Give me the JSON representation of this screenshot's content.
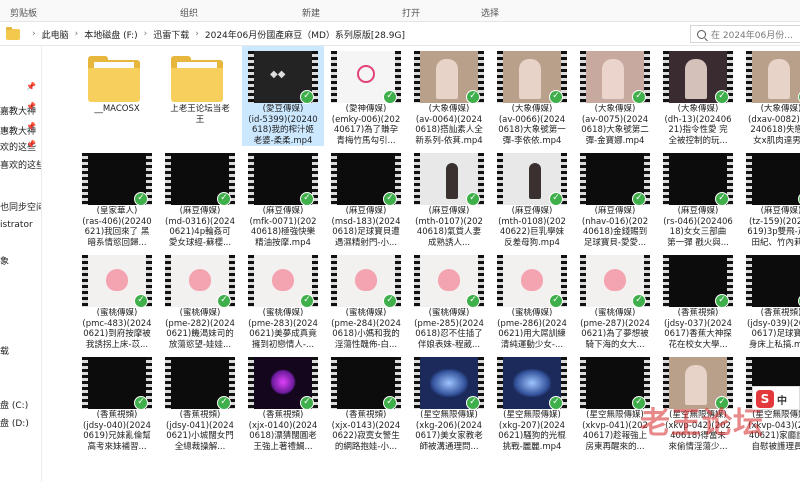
{
  "ribbon": {
    "items": [
      "剪贴板",
      "组织",
      "新建",
      "打开",
      "选择"
    ]
  },
  "address": {
    "crumbs": [
      "此电脑",
      "本地磁盘 (F:)",
      "迅雷下载",
      "2024年06月份國產麻豆（MD）系列原版[28.9G]"
    ],
    "search_placeholder": "在 2024年06月份..."
  },
  "sidebar": {
    "items": [
      "嘉教大神",
      "惠教大神",
      "欢的这些",
      "喜欢的这些",
      "也同步空间",
      "istrator",
      "象",
      "载",
      "盘 (C:)",
      "盘 (D:)"
    ]
  },
  "folders": [
    {
      "name": "__MACOSX"
    },
    {
      "name": "上老王论坛当老\n王"
    }
  ],
  "videos": [
    {
      "caption": "(愛豆傳媒)\n(id-5399)(20240\n618)我的榨汁姬\n老婆-柔柔.mp4",
      "scene": "logo-dark",
      "selected": true
    },
    {
      "caption": "(愛神傳媒)\n(emky-006)(202\n40617)為了賺孕\n青梅竹馬勾引...",
      "scene": "logo-white"
    },
    {
      "caption": "(大象傳媒)\n(av-0064)(2024\n0618)搭訕素人全\n新系列-依萁.mp4",
      "scene": "room"
    },
    {
      "caption": "(大象傳媒)\n(av-0066)(2024\n0618)大象號第一\n彈-李依依.mp4",
      "scene": "room"
    },
    {
      "caption": "(大象傳媒)\n(av-0075)(2024\n0618)大象號第二\n彈-金寶娜.mp4",
      "scene": "room2"
    },
    {
      "caption": "(大象傳媒)\n(dh-13)(202406\n21)指令性愛 完\n全被控制的玩...",
      "scene": "dark"
    },
    {
      "caption": "(大象傳媒)\n(dxav-0082)(20\n240618)失戀少\n女x肌肉達男...",
      "scene": "room"
    },
    {
      "caption": "(皇家華人)\n(ras-406)(20240\n621)我回來了 黑\n暗系情慾回歸...",
      "scene": "black"
    },
    {
      "caption": "(麻豆傳媒)\n(md-0316)(2024\n0621)4p輪姦可\n愛女球經-蘇櫻...",
      "scene": "black"
    },
    {
      "caption": "(麻豆傳媒)\n(mfk-0071)(202\n40618)極強快樂\n精油按摩.mp4",
      "scene": "black"
    },
    {
      "caption": "(麻豆傳媒)\n(msd-183)(2024\n0618)足球寶貝遭\n遇濕精射門-小...",
      "scene": "black"
    },
    {
      "caption": "(麻豆傳媒)\n(mth-0107)(202\n40618)氣質人妻\n成熟誘人...",
      "scene": "white"
    },
    {
      "caption": "(麻豆傳媒)\n(mth-0108)(202\n40622)巨乳學妹\n反差母狗.mp4",
      "scene": "white"
    },
    {
      "caption": "(麻豆傳媒)\n(nhav-016)(202\n40618)金錢賜到\n足球寶貝-愛愛...",
      "scene": "black"
    },
    {
      "caption": "(麻豆傳媒)\n(rs-046)(202406\n18)女女三部曲\n第一彈 戳火與...",
      "scene": "black"
    },
    {
      "caption": "(麻豆傳媒)\n(tz-159)(20240\n619)3p雙飛-芹澤\n田紀、竹內莉...",
      "scene": "black"
    },
    {
      "caption": "(蜜桃傳媒)\n(pmc-483)(2024\n0621)到府按摩被\n我誘拐上床-苡...",
      "scene": "peach"
    },
    {
      "caption": "(蜜桃傳媒)\n(pme-282)(2024\n0621)饑渴妹司的\n放蕩慾望-娃娃...",
      "scene": "peach"
    },
    {
      "caption": "(蜜桃傳媒)\n(pme-283)(2024\n0621)美夢成真竟\n擁到初戀情人-...",
      "scene": "peach"
    },
    {
      "caption": "(蜜桃傳媒)\n(pme-284)(2024\n0618)小媽和我的\n淫蕩性醜佈-白...",
      "scene": "peach"
    },
    {
      "caption": "(蜜桃傳媒)\n(pme-285)(2024\n0618)忍不住插了\n伴娘表妹-程葳...",
      "scene": "peach"
    },
    {
      "caption": "(蜜桃傳媒)\n(pme-286)(2024\n0621)用大屌訓練\n清純運動少女-...",
      "scene": "peach"
    },
    {
      "caption": "(蜜桃傳媒)\n(pme-287)(2024\n0621)為了夢想被\n騎下海的女大...",
      "scene": "peach"
    },
    {
      "caption": "(香蕉視頻)\n(jdsy-037)(2024\n0617)香蕉大神探\n花在校女大學...",
      "scene": "black"
    },
    {
      "caption": "(香蕉視頻)\n(jdsy-039)(2024\n0617)足球寶貝\n身床上私搞.mp4",
      "scene": "black"
    },
    {
      "caption": "(香蕉視頻)\n(jdsy-040)(2024\n0619)兄妹亂倫幫\n高考來妹補習...",
      "scene": "black"
    },
    {
      "caption": "(香蕉視頻)\n(jdsy-041)(2024\n0621)小城闊女門\n全總裁操解...",
      "scene": "black"
    },
    {
      "caption": "(香蕉視頻)\n(xjx-0140)(2024\n0618)漂猜闊圓老\n王強上著禮鯛...",
      "scene": "purple"
    },
    {
      "caption": "(香蕉視頻)\n(xjx-0143)(2024\n0622)寂寞女警生\n的網路抱娃-小...",
      "scene": "black"
    },
    {
      "caption": "(星空無限傳媒)\n(xkg-206)(2024\n0617)美女家教老\n師被溝通理問...",
      "scene": "blue"
    },
    {
      "caption": "(星空無限傳媒)\n(xkg-207)(2024\n0621)騷狗的光棍\n挑戰-麗麗.mp4",
      "scene": "blue"
    },
    {
      "caption": "(星空無限傳媒)\n(xkvp-041)(202\n40617)趁報強上\n房東再醒來的...",
      "scene": "black"
    },
    {
      "caption": "(星空無限傳媒)\n(xkvp-042)(202\n40618)得當未\n來偷情淫蕩少...",
      "scene": "room"
    },
    {
      "caption": "(星空無限傳媒)\n(xkvp-043)(202\n40621)家廳護士\n自慰被護理員...",
      "scene": "black"
    }
  ],
  "watermark": {
    "text": "老王论坛",
    "brand": "中"
  },
  "colors": {
    "selection": "#cce8ff",
    "sync_badge": "#3eaf4a",
    "folder": "#f6cf5c"
  }
}
